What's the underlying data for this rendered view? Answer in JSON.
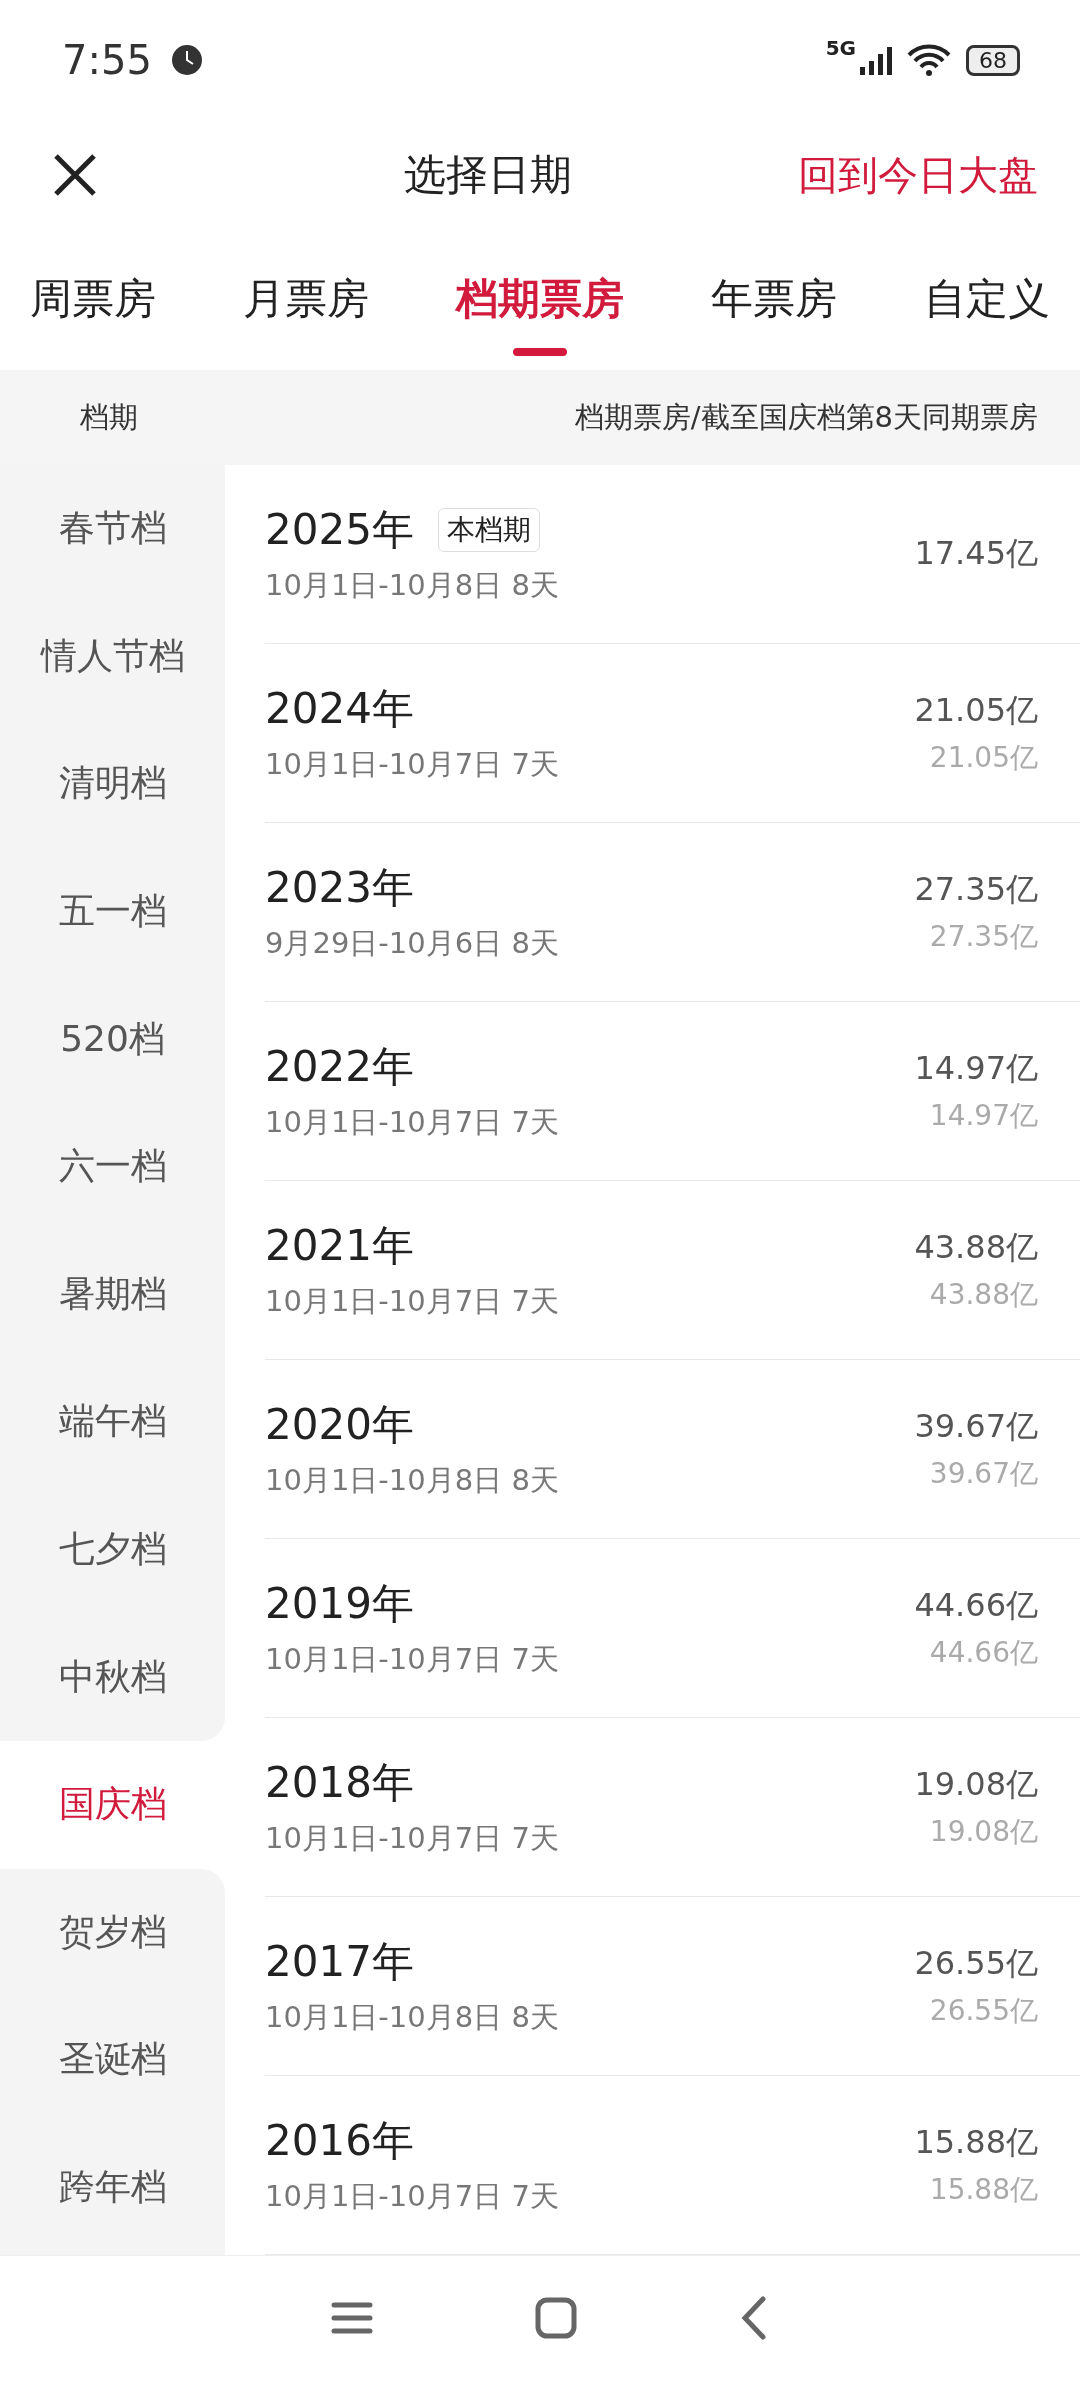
{
  "status_bar": {
    "time": "7:55",
    "network": "5G",
    "battery": "68"
  },
  "header": {
    "title": "选择日期",
    "action": "回到今日大盘"
  },
  "tabs": [
    {
      "label": "周票房",
      "selected": false
    },
    {
      "label": "月票房",
      "selected": false
    },
    {
      "label": "档期票房",
      "selected": true
    },
    {
      "label": "年票房",
      "selected": false
    },
    {
      "label": "自定义",
      "selected": false
    }
  ],
  "column_header": {
    "left": "档期",
    "right": "档期票房/截至国庆档第8天同期票房"
  },
  "sidebar": {
    "items": [
      {
        "label": "春节档",
        "selected": false
      },
      {
        "label": "情人节档",
        "selected": false
      },
      {
        "label": "清明档",
        "selected": false
      },
      {
        "label": "五一档",
        "selected": false
      },
      {
        "label": "520档",
        "selected": false
      },
      {
        "label": "六一档",
        "selected": false
      },
      {
        "label": "暑期档",
        "selected": false
      },
      {
        "label": "端午档",
        "selected": false
      },
      {
        "label": "七夕档",
        "selected": false
      },
      {
        "label": "中秋档",
        "selected": false
      },
      {
        "label": "国庆档",
        "selected": true
      },
      {
        "label": "贺岁档",
        "selected": false
      },
      {
        "label": "圣诞档",
        "selected": false
      },
      {
        "label": "跨年档",
        "selected": false
      }
    ]
  },
  "rows": [
    {
      "year": "2025年",
      "badge": "本档期",
      "dates": "10月1日-10月8日 8天",
      "box_office": "17.45亿"
    },
    {
      "year": "2024年",
      "dates": "10月1日-10月7日 7天",
      "box_office": "21.05亿",
      "same_period": "21.05亿"
    },
    {
      "year": "2023年",
      "dates": "9月29日-10月6日 8天",
      "box_office": "27.35亿",
      "same_period": "27.35亿"
    },
    {
      "year": "2022年",
      "dates": "10月1日-10月7日 7天",
      "box_office": "14.97亿",
      "same_period": "14.97亿"
    },
    {
      "year": "2021年",
      "dates": "10月1日-10月7日 7天",
      "box_office": "43.88亿",
      "same_period": "43.88亿"
    },
    {
      "year": "2020年",
      "dates": "10月1日-10月8日 8天",
      "box_office": "39.67亿",
      "same_period": "39.67亿"
    },
    {
      "year": "2019年",
      "dates": "10月1日-10月7日 7天",
      "box_office": "44.66亿",
      "same_period": "44.66亿"
    },
    {
      "year": "2018年",
      "dates": "10月1日-10月7日 7天",
      "box_office": "19.08亿",
      "same_period": "19.08亿"
    },
    {
      "year": "2017年",
      "dates": "10月1日-10月8日 8天",
      "box_office": "26.55亿",
      "same_period": "26.55亿"
    },
    {
      "year": "2016年",
      "dates": "10月1日-10月7日 7天",
      "box_office": "15.88亿",
      "same_period": "15.88亿"
    }
  ]
}
